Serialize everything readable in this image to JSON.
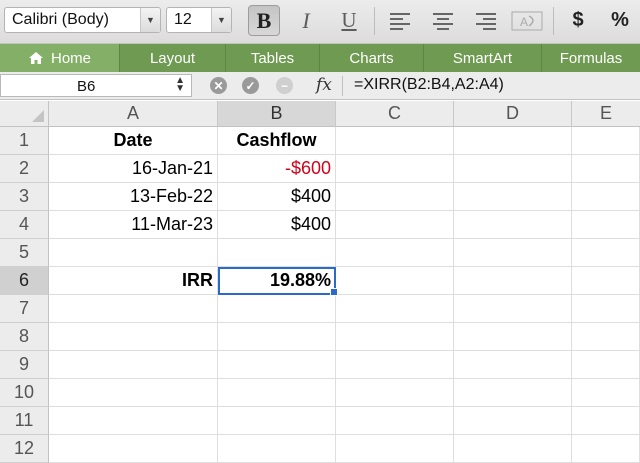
{
  "toolbar": {
    "font_name": "Calibri (Body)",
    "font_size": "12",
    "bold_label": "B",
    "italic_label": "I",
    "underline_label": "U",
    "currency_label": "$",
    "percent_label": "%"
  },
  "ribbon": {
    "tabs": [
      {
        "label": "Home",
        "active": true
      },
      {
        "label": "Layout"
      },
      {
        "label": "Tables"
      },
      {
        "label": "Charts"
      },
      {
        "label": "SmartArt"
      },
      {
        "label": "Formulas"
      }
    ]
  },
  "formula_bar": {
    "cell_ref": "B6",
    "fx_label": "fx",
    "formula": "=XIRR(B2:B4,A2:A4)"
  },
  "grid": {
    "columns": [
      "A",
      "B",
      "C",
      "D",
      "E"
    ],
    "selected_column": "B",
    "rows": [
      "1",
      "2",
      "3",
      "4",
      "5",
      "6",
      "7",
      "8",
      "9",
      "10",
      "11",
      "12"
    ],
    "selected_row": "6",
    "cells": {
      "A1": "Date",
      "B1": "Cashflow",
      "A2": "16-Jan-21",
      "B2": "-$600",
      "A3": "13-Feb-22",
      "B3": "$400",
      "A4": "11-Mar-23",
      "B4": "$400",
      "A6": "IRR",
      "B6": "19.88%"
    },
    "colors": {
      "negative": "#d0021b",
      "selection": "#2a6ac9",
      "ribbon": "#6f9a52"
    }
  }
}
